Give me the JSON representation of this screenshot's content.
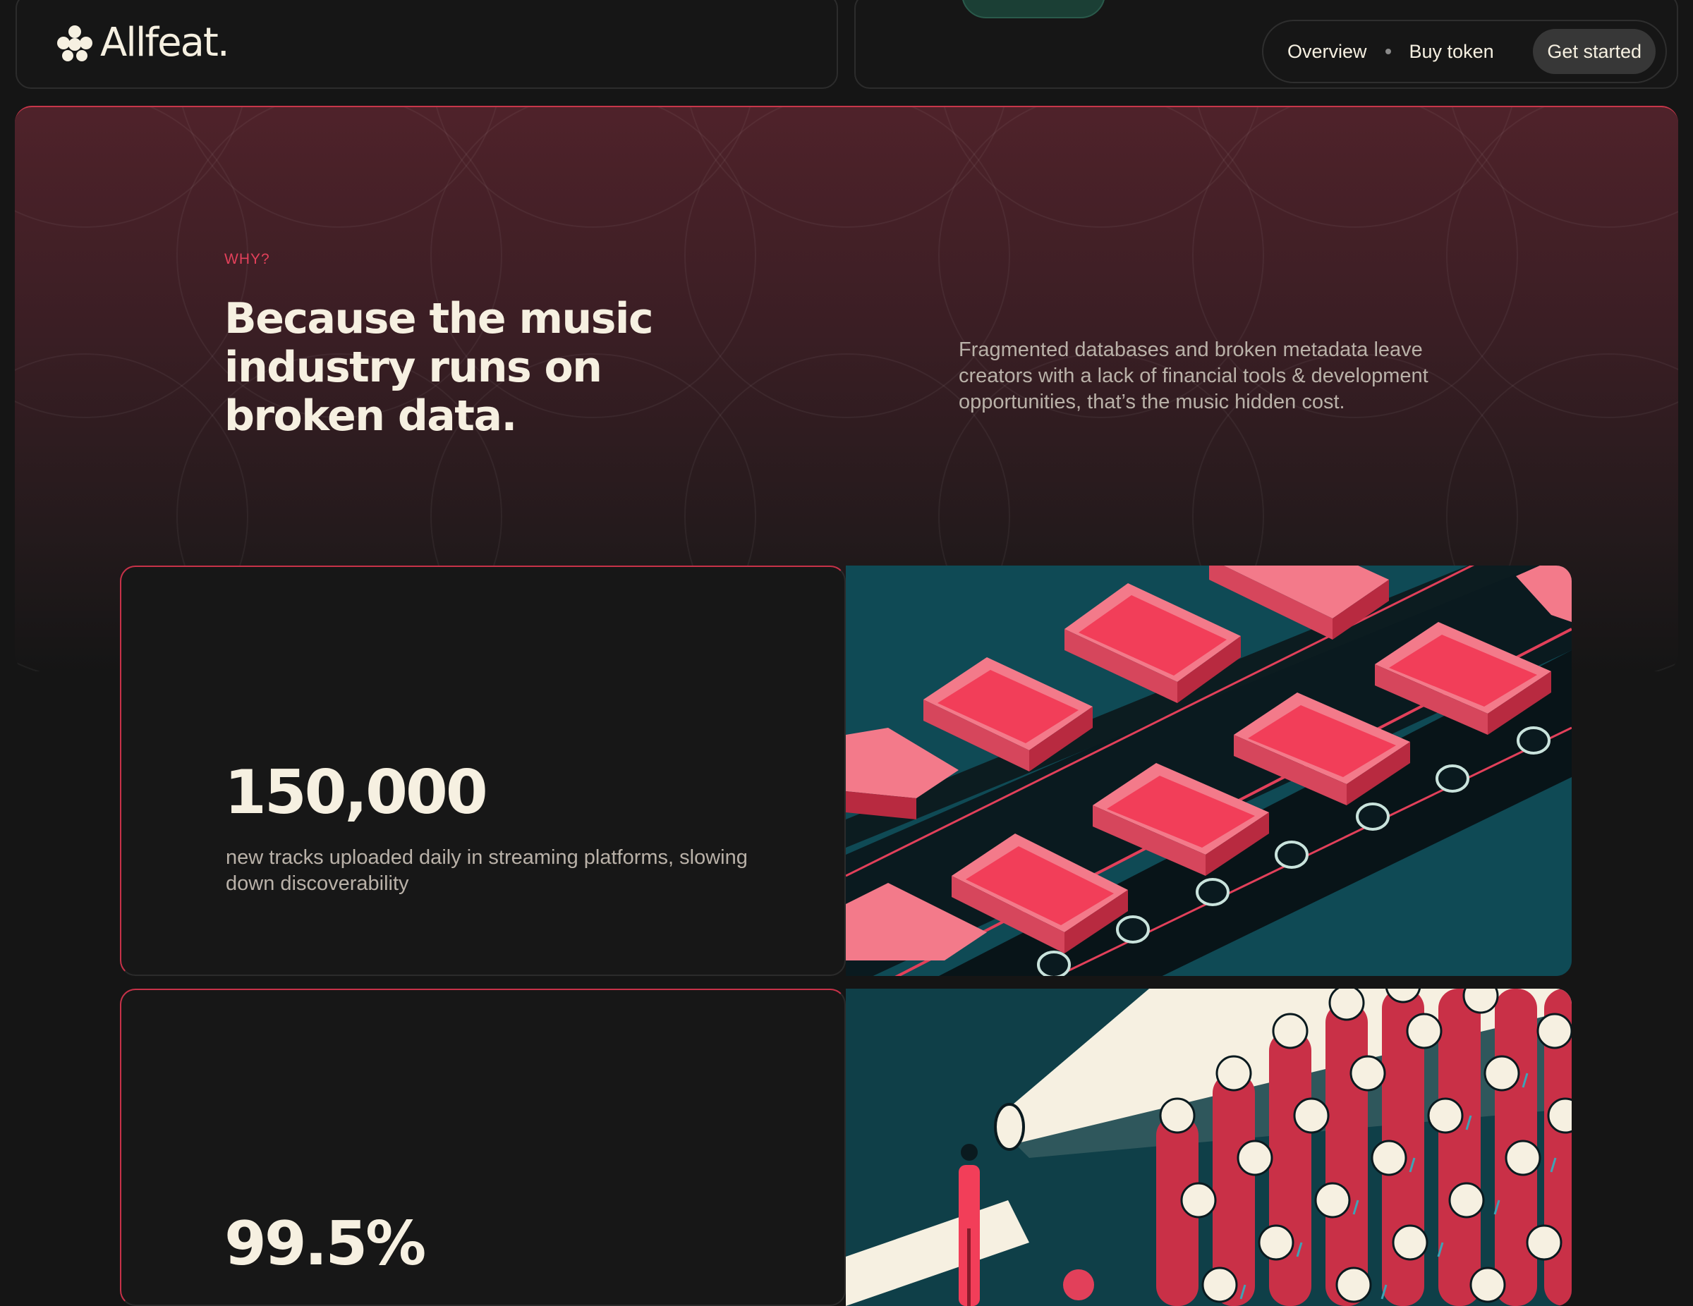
{
  "header": {
    "brand": "Allfeat.",
    "nav": {
      "overview": "Overview",
      "buy_token": "Buy token",
      "cta": "Get started"
    }
  },
  "hero": {
    "eyebrow": "WHY?",
    "headline": "Because the music industry runs on broken data.",
    "description": "Fragmented databases and broken metadata leave creators with a lack of financial tools & development opportunities, that’s the music hidden cost."
  },
  "stats": [
    {
      "value": "150,000",
      "description": "new tracks uploaded daily in streaming platforms, slowing down discoverability"
    },
    {
      "value": "99.5%"
    }
  ],
  "colors": {
    "background": "#151515",
    "accent": "#e2405a",
    "cream": "#f6f0e1",
    "teal": "#0f4550",
    "muted_text": "#b9b1a8"
  }
}
